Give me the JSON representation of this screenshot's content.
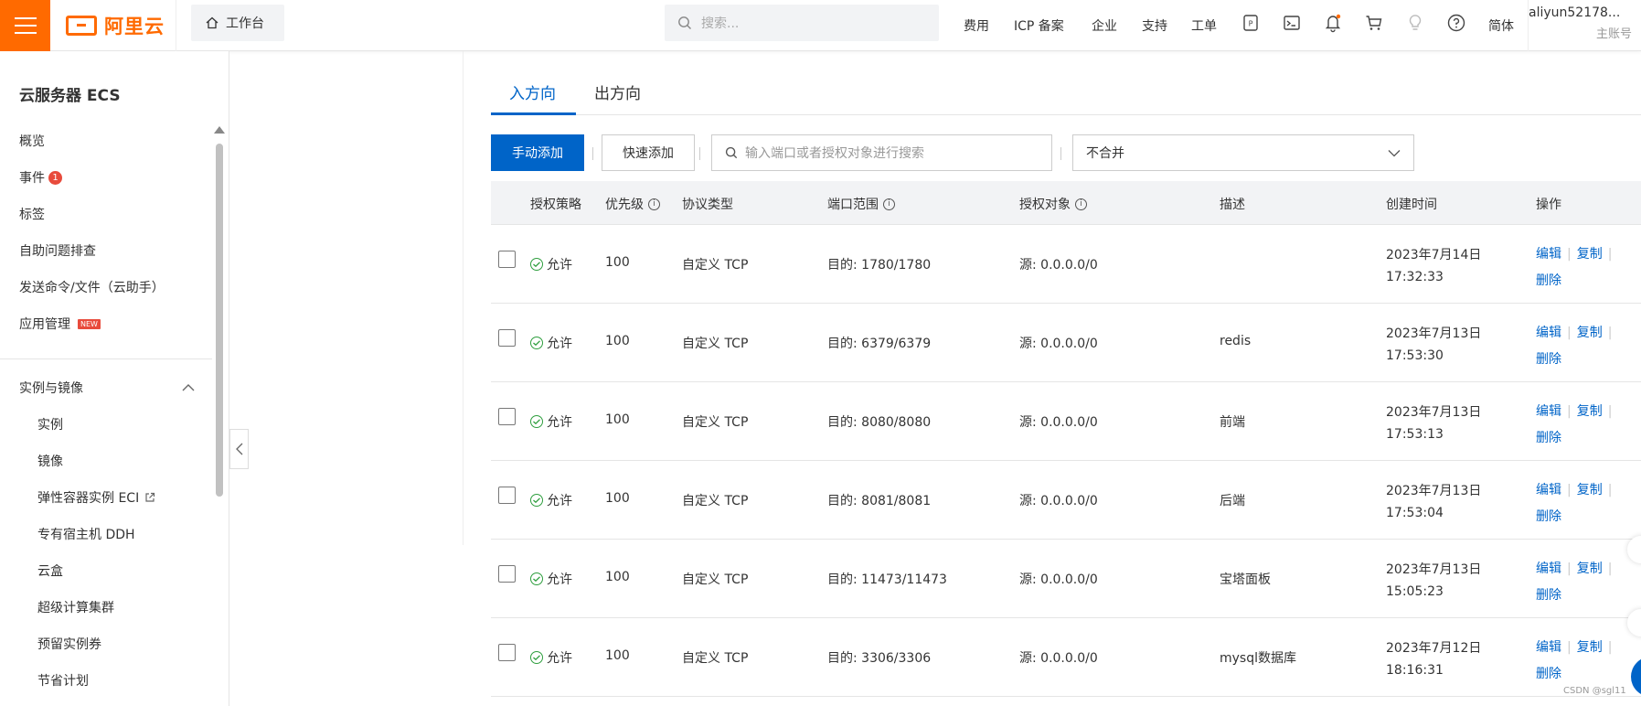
{
  "topbar": {
    "brand": "阿里云",
    "workbench": "工作台",
    "search_placeholder": "搜索...",
    "nav": [
      "费用",
      "ICP 备案",
      "企业",
      "支持",
      "工单"
    ],
    "lang": "简体",
    "account_name": "aliyun52178...",
    "account_role": "主账号",
    "icons": [
      "icp-icon",
      "terminal-icon",
      "bell-icon",
      "cart-icon",
      "bulb-icon",
      "help-icon"
    ]
  },
  "sidebar": {
    "title": "云服务器 ECS",
    "items": [
      {
        "label": "概览"
      },
      {
        "label": "事件",
        "badge": "1"
      },
      {
        "label": "标签"
      },
      {
        "label": "自助问题排查"
      },
      {
        "label": "发送命令/文件（云助手）"
      },
      {
        "label": "应用管理",
        "tag": "NEW"
      }
    ],
    "group": "实例与镜像",
    "sub_items": [
      "实例",
      "镜像",
      "弹性容器实例 ECI",
      "专有宿主机 DDH",
      "云盒",
      "超级计算集群",
      "预留实例券",
      "节省计划"
    ]
  },
  "tabs": [
    "入方向",
    "出方向"
  ],
  "toolbar": {
    "manual_add": "手动添加",
    "quick_add": "快速添加",
    "search_placeholder": "输入端口或者授权对象进行搜索",
    "merge_select": "不合并"
  },
  "table": {
    "headers": [
      "授权策略",
      "优先级",
      "协议类型",
      "端口范围",
      "授权对象",
      "描述",
      "创建时间",
      "操作"
    ],
    "rows": [
      {
        "policy": "允许",
        "priority": "100",
        "protocol": "自定义 TCP",
        "port": "目的: 1780/1780",
        "source": "源: 0.0.0.0/0",
        "desc": "",
        "date": "2023年7月14日",
        "time": "17:32:33"
      },
      {
        "policy": "允许",
        "priority": "100",
        "protocol": "自定义 TCP",
        "port": "目的: 6379/6379",
        "source": "源: 0.0.0.0/0",
        "desc": "redis",
        "date": "2023年7月13日",
        "time": "17:53:30"
      },
      {
        "policy": "允许",
        "priority": "100",
        "protocol": "自定义 TCP",
        "port": "目的: 8080/8080",
        "source": "源: 0.0.0.0/0",
        "desc": "前端",
        "date": "2023年7月13日",
        "time": "17:53:13"
      },
      {
        "policy": "允许",
        "priority": "100",
        "protocol": "自定义 TCP",
        "port": "目的: 8081/8081",
        "source": "源: 0.0.0.0/0",
        "desc": "后端",
        "date": "2023年7月13日",
        "time": "17:53:04"
      },
      {
        "policy": "允许",
        "priority": "100",
        "protocol": "自定义 TCP",
        "port": "目的: 11473/11473",
        "source": "源: 0.0.0.0/0",
        "desc": "宝塔面板",
        "date": "2023年7月13日",
        "time": "15:05:23"
      },
      {
        "policy": "允许",
        "priority": "100",
        "protocol": "自定义 TCP",
        "port": "目的: 3306/3306",
        "source": "源: 0.0.0.0/0",
        "desc": "mysql数据库",
        "date": "2023年7月12日",
        "time": "18:16:31"
      }
    ],
    "ops": {
      "edit": "编辑",
      "copy": "复制",
      "delete": "删除"
    }
  },
  "watermark": "CSDN @sgl11",
  "colors": {
    "brand": "#ff6a00",
    "primary": "#0064c8",
    "badge": "#e84b3c",
    "success": "#2e9e3e"
  }
}
